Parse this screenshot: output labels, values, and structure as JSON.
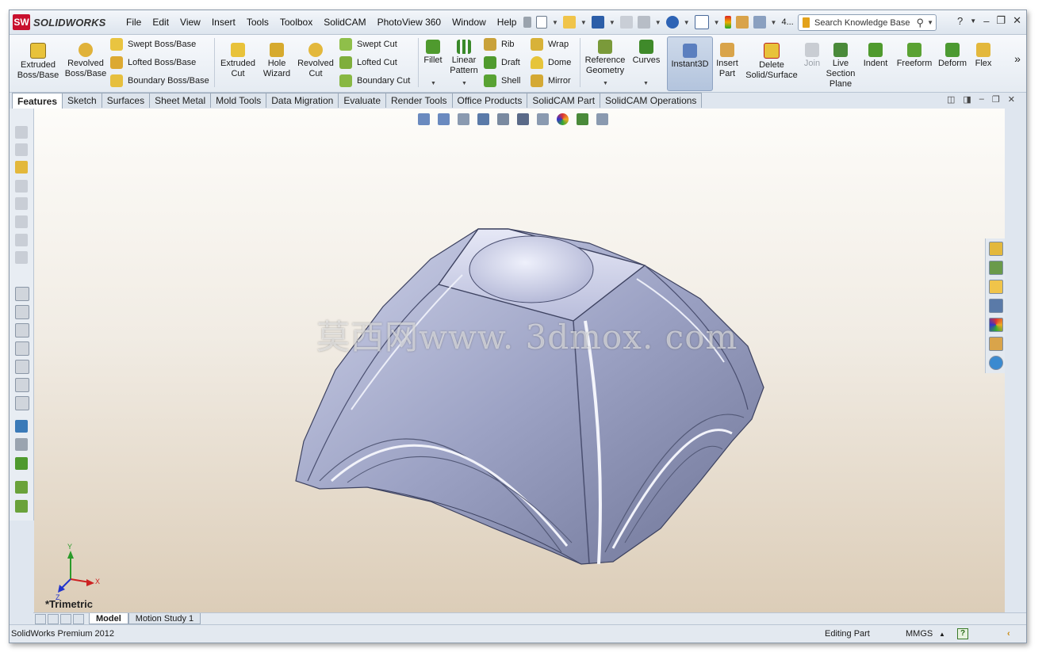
{
  "app": {
    "name": "SOLIDWORKS",
    "logo_mark": "SW"
  },
  "menu": [
    "File",
    "Edit",
    "View",
    "Insert",
    "Tools",
    "Toolbox",
    "SolidCAM",
    "PhotoView 360",
    "Window",
    "Help"
  ],
  "quick_access": {
    "trailing_label": "4..."
  },
  "search": {
    "placeholder": "Search Knowledge Base"
  },
  "window_controls": {
    "help": "?",
    "minimize": "–",
    "restore": "❐",
    "close": "✕"
  },
  "ribbon": {
    "extruded_boss": "Extruded Boss/Base",
    "revolved_boss": "Revolved Boss/Base",
    "swept_boss": "Swept Boss/Base",
    "lofted_boss": "Lofted Boss/Base",
    "boundary_boss": "Boundary Boss/Base",
    "extruded_cut": "Extruded Cut",
    "hole_wizard": "Hole Wizard",
    "revolved_cut": "Revolved Cut",
    "swept_cut": "Swept Cut",
    "lofted_cut": "Lofted Cut",
    "boundary_cut": "Boundary Cut",
    "fillet": "Fillet",
    "linear_pattern": "Linear Pattern",
    "rib": "Rib",
    "draft": "Draft",
    "shell": "Shell",
    "wrap": "Wrap",
    "dome": "Dome",
    "mirror": "Mirror",
    "reference_geometry": "Reference Geometry",
    "curves": "Curves",
    "instant3d": "Instant3D",
    "insert_part": "Insert Part",
    "delete_solid": "Delete Solid/Surface",
    "join": "Join",
    "live_section": "Live Section Plane",
    "indent": "Indent",
    "freeform": "Freeform",
    "deform": "Deform",
    "flex": "Flex",
    "more": "»"
  },
  "tabs": [
    "Features",
    "Sketch",
    "Surfaces",
    "Sheet Metal",
    "Mold Tools",
    "Data Migration",
    "Evaluate",
    "Render Tools",
    "Office Products",
    "SolidCAM Part",
    "SolidCAM Operations"
  ],
  "viewport": {
    "view_name": "*Trimetric",
    "watermark": "莫西网www. 3dmox. com",
    "triad": {
      "x": "X",
      "y": "Y",
      "z": "Z"
    }
  },
  "bottom_tabs": [
    "Model",
    "Motion Study 1"
  ],
  "status": {
    "product": "SolidWorks Premium 2012",
    "mode": "Editing Part",
    "units": "MMGS",
    "units_arrow": "▲",
    "help": "?",
    "collapse": "‹"
  },
  "colors": {
    "accent": "#c8102e",
    "part_body": "#9ca2c4",
    "viewport_top": "#fdfcf9",
    "viewport_bottom": "#dccdb8"
  }
}
